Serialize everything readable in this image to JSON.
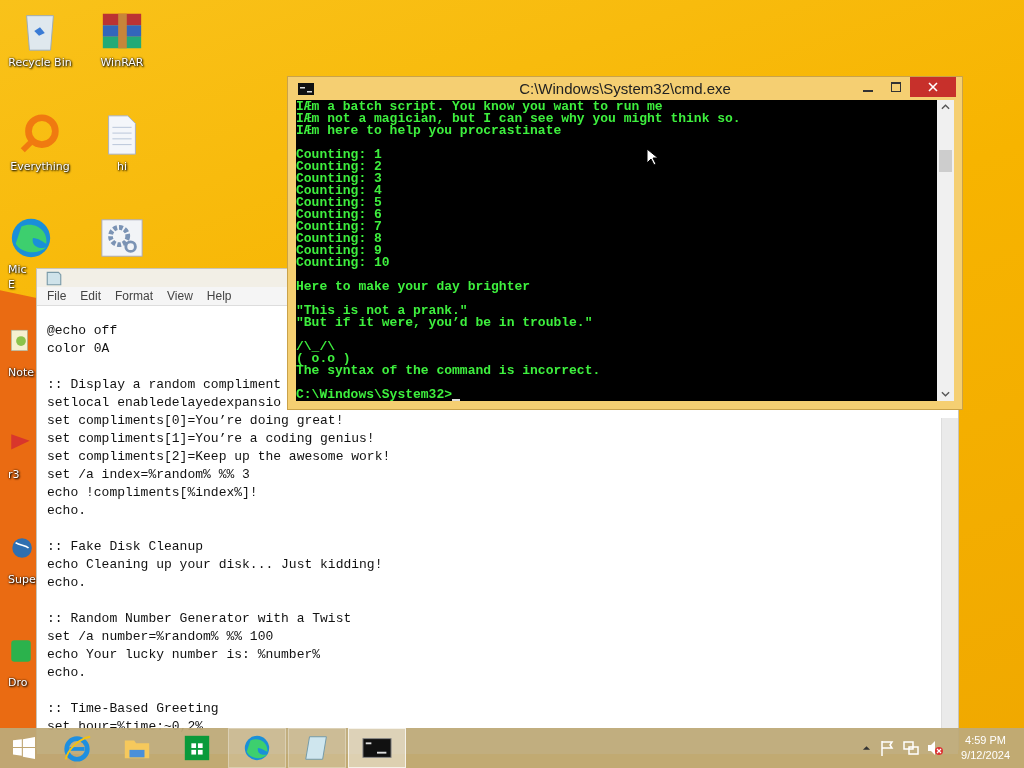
{
  "desktop_icons": [
    {
      "label": "Recycle Bin",
      "kind": "recycle"
    },
    {
      "label": "WinRAR",
      "kind": "archive"
    },
    {
      "label": "Everything",
      "kind": "search-ring"
    },
    {
      "label": "hi",
      "kind": "document"
    },
    {
      "label": "Mic",
      "label2": "E",
      "kind": "edge"
    },
    {
      "kind": "gears"
    },
    {
      "label": "Note",
      "kind": "notepadpp"
    },
    {
      "label": "r3",
      "kind": "red"
    },
    {
      "label": "Supe",
      "kind": "globe"
    },
    {
      "label": "Dro",
      "kind": "green"
    }
  ],
  "notepad_window": {
    "menu": [
      "File",
      "Edit",
      "Format",
      "View",
      "Help"
    ],
    "blocks": [
      [
        "@echo off",
        "color 0A"
      ],
      [
        ":: Display a random compliment",
        "setlocal enabledelayedexpansio",
        "set compliments[0]=You’re doing great!",
        "set compliments[1]=You’re a coding genius!",
        "set compliments[2]=Keep up the awesome work!",
        "set /a index=%random% %% 3",
        "echo !compliments[%index%]!",
        "echo."
      ],
      [
        ":: Fake Disk Cleanup",
        "echo Cleaning up your disk... Just kidding!",
        "echo."
      ],
      [
        ":: Random Number Generator with a Twist",
        "set /a number=%random% %% 100",
        "echo Your lucky number is: %number%",
        "echo."
      ],
      [
        ":: Time-Based Greeting",
        "set hour=%time:~0,2%"
      ]
    ]
  },
  "cmd_window": {
    "title": "C:\\Windows\\System32\\cmd.exe",
    "blocks": [
      [
        "IÆm a batch script. You know you want to run me",
        "IÆm not a magician, but I can see why you might think so.",
        "IÆm here to help you procrastinate"
      ],
      [
        "Counting: 1",
        "Counting: 2",
        "Counting: 3",
        "Counting: 4",
        "Counting: 5",
        "Counting: 6",
        "Counting: 7",
        "Counting: 8",
        "Counting: 9",
        "Counting: 10"
      ],
      [
        "Here to make your day brighter"
      ],
      [
        "\"This is not a prank.\"",
        "\"But if it were, you’d be in trouble.\""
      ],
      [
        "/\\_/\\",
        "( o.o )",
        "The syntax of the command is incorrect."
      ]
    ],
    "prompt": "C:\\Windows\\System32>"
  },
  "taskbar": {
    "apps": [
      {
        "kind": "ie",
        "open": false,
        "selected": false
      },
      {
        "kind": "explorer",
        "open": false,
        "selected": false
      },
      {
        "kind": "store",
        "open": false,
        "selected": false
      },
      {
        "kind": "edge",
        "open": true,
        "selected": false
      },
      {
        "kind": "notepad",
        "open": true,
        "selected": false
      },
      {
        "kind": "cmd",
        "open": true,
        "selected": true
      }
    ],
    "time": "4:59 PM",
    "date": "9/12/2024"
  }
}
